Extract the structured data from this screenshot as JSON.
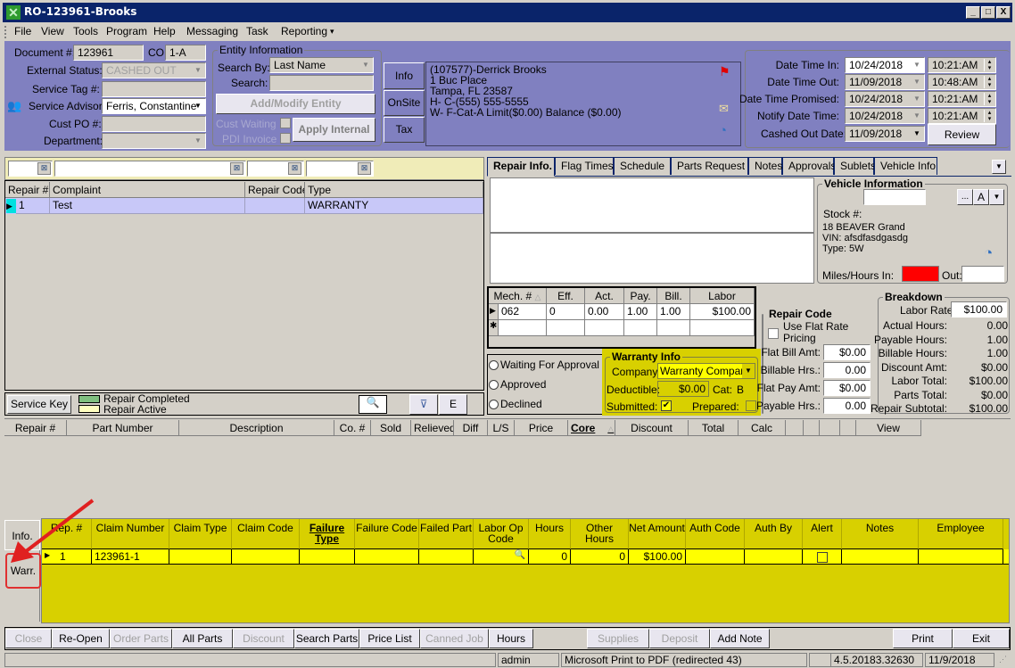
{
  "window": {
    "title": "RO-123961-Brooks",
    "minimize": "_",
    "maximize": "□",
    "close": "X"
  },
  "menu": [
    "File",
    "View",
    "Tools",
    "Program",
    "Help",
    "Messaging",
    "Task",
    "Reporting"
  ],
  "header": {
    "document_label": "Document #:",
    "document_value": "123961",
    "co_label": "CO",
    "co_value": "1-A",
    "external_status_label": "External Status:",
    "external_status_value": "CASHED OUT",
    "service_tag_label": "Service Tag #:",
    "service_tag_value": "",
    "service_advisor_label": "Service Advisor:",
    "service_advisor_value": "Ferris, Constantine",
    "cust_po_label": "Cust PO #:",
    "cust_po_value": "",
    "department_label": "Department:",
    "department_value": ""
  },
  "entity": {
    "group_title": "Entity Information",
    "search_by_label": "Search By:",
    "search_by_value": "Last Name",
    "search_label": "Search:",
    "search_value": "",
    "add_modify_button": "Add/Modify Entity",
    "cust_waiting_label": "Cust Waiting",
    "pdi_invoice_label": "PDI Invoice",
    "apply_internal_button": "Apply Internal",
    "side_buttons": [
      "Info",
      "OnSite",
      "Tax"
    ],
    "details": [
      "(107577)-Derrick Brooks",
      "1 Buc Place",
      "Tampa, FL 23587",
      "H- C-(555) 555-5555",
      "W- F-Cat-A Limit($0.00) Balance ($0.00)"
    ]
  },
  "dates": {
    "rows": [
      {
        "label": "Date Time In:",
        "date": "10/24/2018",
        "time": "10:21:AM"
      },
      {
        "label": "Date Time Out:",
        "date": "11/09/2018",
        "time": "10:48:AM"
      },
      {
        "label": "Date Time Promised:",
        "date": "10/24/2018",
        "time": "10:21:AM"
      },
      {
        "label": "Notify Date Time:",
        "date": "10/24/2018",
        "time": "10:21:AM"
      }
    ],
    "cashed_out_label": "Cashed Out Date:",
    "cashed_out_value": "11/09/2018",
    "review_button": "Review"
  },
  "repairs": {
    "columns": [
      "Repair #",
      "Complaint",
      "Repair Code",
      "Type"
    ],
    "rows": [
      {
        "repair": "1",
        "complaint": "Test",
        "code": "",
        "type": "WARRANTY"
      }
    ]
  },
  "service_key": {
    "button": "Service Key",
    "legend": [
      {
        "label": "Repair Completed",
        "color": "#80c080"
      },
      {
        "label": "Repair Active",
        "color": "#ffffc0"
      }
    ],
    "e_button": "E"
  },
  "tabs": [
    "Repair Info.",
    "Flag Times",
    "Schedule",
    "Parts Request",
    "Notes",
    "Approvals",
    "Sublets",
    "Vehicle Info"
  ],
  "vehicle": {
    "title": "Vehicle Information",
    "ellipsis": "...",
    "a_button": "A",
    "stock_label": "Stock #:",
    "description": "18 BEAVER Grand",
    "vin": "VIN: afsdfasdgasdg",
    "type": "Type: 5W",
    "miles_in_label": "Miles/Hours In:",
    "miles_in_value": "",
    "out_label": "Out:",
    "out_value": ""
  },
  "mech": {
    "columns": [
      "Mech. #",
      "Eff.",
      "Act.",
      "Pay.",
      "Bill.",
      "Labor"
    ],
    "rows": [
      {
        "mech": "062",
        "eff": "0",
        "act": "0.00",
        "pay": "1.00",
        "bill": "1.00",
        "labor": "$100.00"
      }
    ]
  },
  "approval": {
    "options": [
      "Waiting For Approval",
      "Approved",
      "Declined"
    ]
  },
  "warranty": {
    "title": "Warranty Info",
    "company_label": "Company:",
    "company_value": "Warranty Company",
    "deductible_label": "Deductible:",
    "deductible_value": "$0.00",
    "cat_label": "Cat:",
    "cat_value": "B",
    "submitted_label": "Submitted:",
    "submitted": true,
    "prepared_label": "Prepared:",
    "prepared": false
  },
  "repair_code": {
    "title": "Repair Code",
    "flat_rate_label": "Use Flat Rate Pricing",
    "fields": [
      {
        "label": "Flat Bill Amt:",
        "value": "$0.00"
      },
      {
        "label": "Billable Hrs.:",
        "value": "0.00"
      },
      {
        "label": "Flat Pay Amt:",
        "value": "$0.00"
      },
      {
        "label": "Payable Hrs.:",
        "value": "0.00"
      }
    ]
  },
  "breakdown": {
    "title": "Breakdown",
    "labor_rate_label": "Labor Rate:",
    "labor_rate_value": "$100.00",
    "rows": [
      {
        "label": "Actual Hours:",
        "value": "0.00"
      },
      {
        "label": "Payable Hours:",
        "value": "1.00"
      },
      {
        "label": "Billable Hours:",
        "value": "1.00"
      },
      {
        "label": "Discount Amt:",
        "value": "$0.00"
      },
      {
        "label": "Labor Total:",
        "value": "$100.00"
      },
      {
        "label": "Parts Total:",
        "value": "$0.00"
      },
      {
        "label": "Repair Subtotal:",
        "value": "$100.00"
      }
    ]
  },
  "parts": {
    "columns": [
      "Repair #",
      "Part Number",
      "Description",
      "Co. #",
      "Sold",
      "Relieved",
      "Diff",
      "L/S",
      "Price",
      "Core",
      "Discount",
      "Total",
      "Calc",
      "",
      "",
      "",
      "",
      "View"
    ]
  },
  "side_tabs": [
    "Info.",
    "Warr."
  ],
  "warranty_grid": {
    "columns": [
      "Rep. #",
      "Claim Number",
      "Claim Type",
      "Claim Code",
      "Failure Type",
      "Failure Code",
      "Failed Part",
      "Labor Op Code",
      "Hours",
      "Other Hours",
      "Net Amount",
      "Auth Code",
      "Auth By",
      "Alert",
      "Notes",
      "Employee"
    ],
    "rows": [
      {
        "rep": "1",
        "claim_number": "123961-1",
        "hours": "0",
        "other_hours": "0",
        "net_amount": "$100.00"
      }
    ]
  },
  "bottom_buttons": [
    {
      "label": "Close",
      "enabled": false
    },
    {
      "label": "Re-Open",
      "enabled": true
    },
    {
      "label": "Order Parts",
      "enabled": false
    },
    {
      "label": "All Parts",
      "enabled": true
    },
    {
      "label": "Discount",
      "enabled": false
    },
    {
      "label": "Search Parts",
      "enabled": true
    },
    {
      "label": "Price List",
      "enabled": true
    },
    {
      "label": "Canned Job",
      "enabled": false
    },
    {
      "label": "Hours",
      "enabled": true
    },
    {
      "label": "Supplies",
      "enabled": false
    },
    {
      "label": "Deposit",
      "enabled": false
    },
    {
      "label": "Add Note",
      "enabled": true
    },
    {
      "label": "Print",
      "enabled": true
    },
    {
      "label": "Exit",
      "enabled": true
    }
  ],
  "status": {
    "user": "admin",
    "printer": "Microsoft Print to PDF (redirected 43)",
    "version": "4.5.20183.32630",
    "date": "11/9/2018"
  }
}
